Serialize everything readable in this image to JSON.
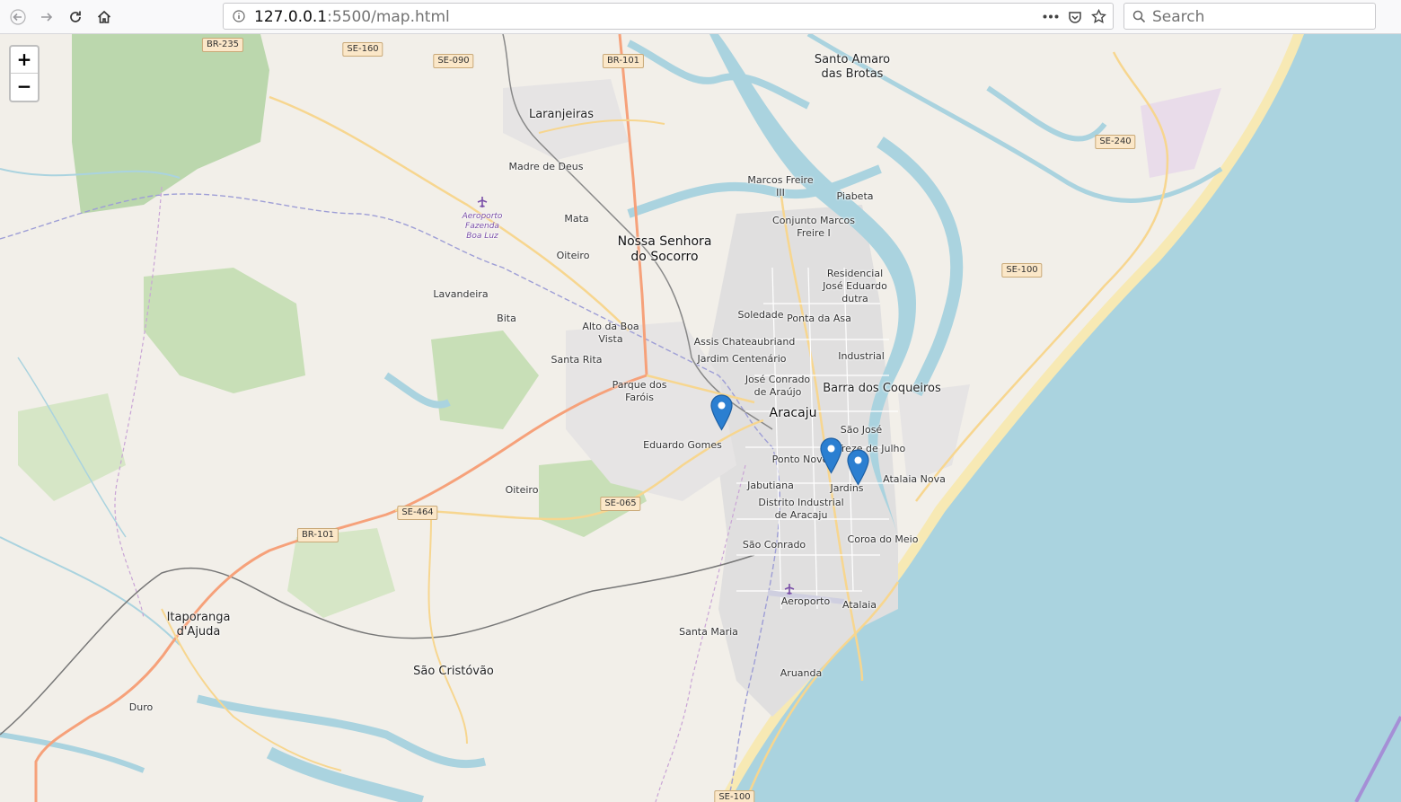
{
  "browser": {
    "url_host": "127.0.0.1",
    "url_rest": ":5500/map.html",
    "search_placeholder": "Search",
    "back_icon": "arrow-left-icon",
    "forward_icon": "arrow-right-icon",
    "reload_icon": "reload-icon",
    "home_icon": "home-icon"
  },
  "zoom": {
    "in": "+",
    "out": "−"
  },
  "colors": {
    "water": "#aad3df",
    "land": "#f2efe9",
    "wood": "#add19e",
    "urban": "#e0dfdf",
    "major_road": "#f6a17a",
    "road": "#f7d68f",
    "marker": "#2b7fd1"
  },
  "places": [
    {
      "text": "Santo Amaro\ndas Brotas",
      "cls": "city"
    },
    {
      "text": "Laranjeiras",
      "cls": "city"
    },
    {
      "text": "Madre de Deus",
      "cls": ""
    },
    {
      "text": "Mata",
      "cls": ""
    },
    {
      "text": "Nossa Senhora\ndo Socorro",
      "cls": "big"
    },
    {
      "text": "Oiteiro",
      "cls": ""
    },
    {
      "text": "Lavandeira",
      "cls": ""
    },
    {
      "text": "Bita",
      "cls": ""
    },
    {
      "text": "Alto da Boa\nVista",
      "cls": ""
    },
    {
      "text": "Santa Rita",
      "cls": ""
    },
    {
      "text": "Parque dos\nFaróis",
      "cls": ""
    },
    {
      "text": "Eduardo Gomes",
      "cls": ""
    },
    {
      "text": "Oiteiro",
      "cls": ""
    },
    {
      "text": "Marcos Freire\nIII",
      "cls": ""
    },
    {
      "text": "Piabeta",
      "cls": ""
    },
    {
      "text": "Conjunto Marcos\nFreire I",
      "cls": ""
    },
    {
      "text": "Residencial\nJosé Eduardo\ndutra",
      "cls": ""
    },
    {
      "text": "Soledade",
      "cls": ""
    },
    {
      "text": "Ponta da Asa",
      "cls": ""
    },
    {
      "text": "Assis Chateaubriand",
      "cls": ""
    },
    {
      "text": "Jardim Centenário",
      "cls": ""
    },
    {
      "text": "Industrial",
      "cls": ""
    },
    {
      "text": "José Conrado\nde Araújo",
      "cls": ""
    },
    {
      "text": "Barra dos Coqueiros",
      "cls": "city"
    },
    {
      "text": "Aracaju",
      "cls": "big"
    },
    {
      "text": "São José",
      "cls": ""
    },
    {
      "text": "Treze de Julho",
      "cls": ""
    },
    {
      "text": "Ponto Novo",
      "cls": ""
    },
    {
      "text": "Jardins",
      "cls": ""
    },
    {
      "text": "Atalaia Nova",
      "cls": ""
    },
    {
      "text": "Jabutiana",
      "cls": ""
    },
    {
      "text": "Distrito Industrial\nde Aracaju",
      "cls": ""
    },
    {
      "text": "Coroa do Meio",
      "cls": ""
    },
    {
      "text": "São Conrado",
      "cls": ""
    },
    {
      "text": "Aeroporto",
      "cls": ""
    },
    {
      "text": "Atalaia",
      "cls": ""
    },
    {
      "text": "Santa Maria",
      "cls": ""
    },
    {
      "text": "Aruanda",
      "cls": ""
    },
    {
      "text": "Itaporanga\nd'Ajuda",
      "cls": "city"
    },
    {
      "text": "São Cristóvão",
      "cls": "city"
    },
    {
      "text": "Duro",
      "cls": ""
    },
    {
      "text": "Aeroporto\nFazenda\nBoa Luz",
      "cls": "air"
    }
  ],
  "road_shields": [
    "BR-235",
    "SE-160",
    "SE-090",
    "BR-101",
    "SE-240",
    "SE-100",
    "SE-464",
    "BR-101",
    "SE-065",
    "SE-100"
  ],
  "markers": [
    {
      "name": "marker-1",
      "icon": "map-pin-icon"
    },
    {
      "name": "marker-2",
      "icon": "map-pin-icon"
    },
    {
      "name": "marker-3",
      "icon": "map-pin-icon"
    }
  ]
}
